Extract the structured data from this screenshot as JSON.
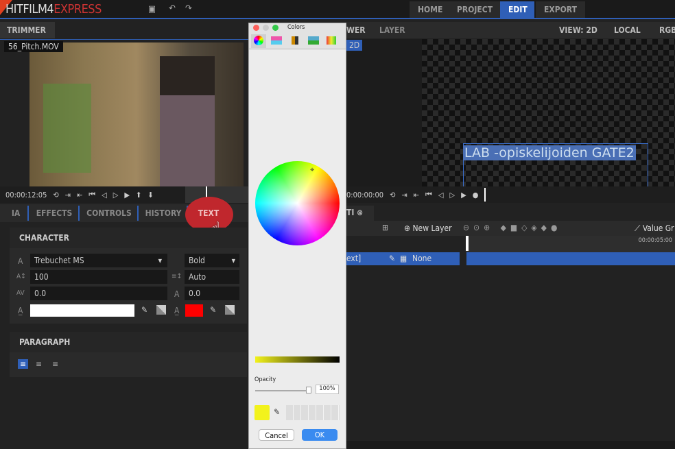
{
  "app": {
    "logo_main": "HITFILM4",
    "logo_accent": "EXPRESS",
    "nav": [
      "HOME",
      "PROJECT",
      "EDIT",
      "EXPORT"
    ],
    "active_nav": "EDIT"
  },
  "trimmer": {
    "title": "TRIMMER",
    "filename": "56_Pitch.MOV",
    "timecode": "00:00:12:05"
  },
  "viewer": {
    "tabs": [
      "WER",
      "LAYER"
    ],
    "badge": "2D",
    "view": "VIEW: 2D",
    "space": "LOCAL",
    "channel": "RGB",
    "overlay_text": "LAB -opiskelijoiden GATE2",
    "timecode": "0:00:00:00"
  },
  "panel_tabs": [
    "IA",
    "EFFECTS",
    "CONTROLS",
    "HISTORY",
    "TEXT"
  ],
  "active_tab": "TEXT",
  "character": {
    "title": "CHARACTER",
    "font": "Trebuchet MS",
    "style": "Bold",
    "size": "100",
    "leading": "Auto",
    "tracking": "0.0",
    "baseline": "0.0",
    "fill_color": "#ffffff",
    "stroke_color": "#ff0000"
  },
  "paragraph": {
    "title": "PARAGRAPH"
  },
  "timeline": {
    "tab": "TI",
    "new_layer": "New Layer",
    "value_graph": "Value Gr",
    "time_marker": "00:00:05:00",
    "layer_name": "ext]",
    "blend": "None"
  },
  "colors_dialog": {
    "title": "Colors",
    "opacity_label": "Opacity",
    "opacity_value": "100%",
    "cancel": "Cancel",
    "ok": "OK",
    "selected_color": "#f2f21c"
  }
}
